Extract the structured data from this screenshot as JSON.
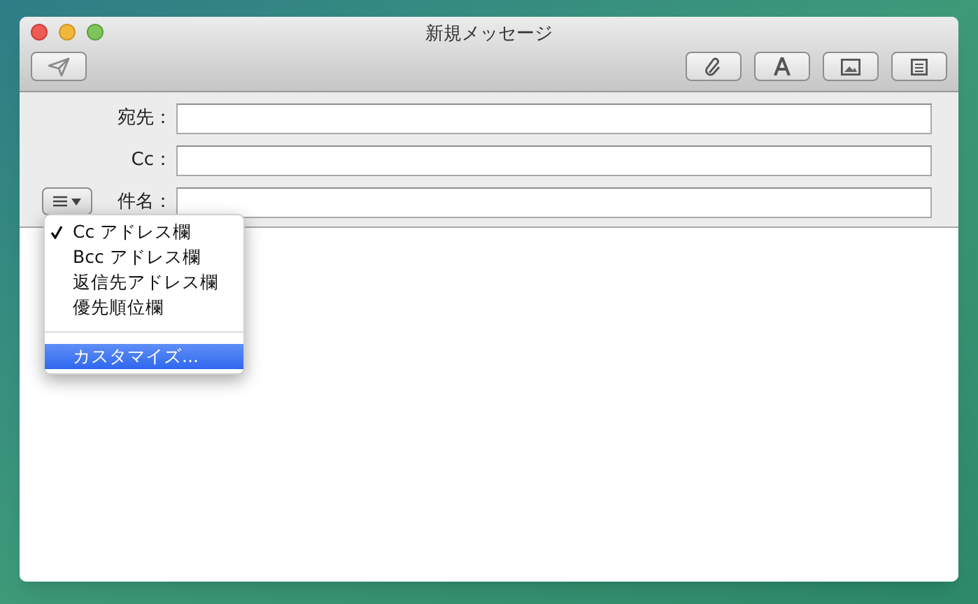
{
  "window": {
    "title": "新規メッセージ"
  },
  "header_fields": [
    {
      "label": "宛先："
    },
    {
      "label": "Cc："
    },
    {
      "label": "件名："
    }
  ],
  "menu": {
    "items": [
      {
        "kind": "toggle",
        "label": "Cc アドレス欄",
        "checked": true,
        "selected": false
      },
      {
        "kind": "toggle",
        "label": "Bcc アドレス欄",
        "checked": false,
        "selected": false
      },
      {
        "kind": "toggle",
        "label": "返信先アドレス欄",
        "checked": false,
        "selected": false
      },
      {
        "kind": "toggle",
        "label": "優先順位欄",
        "checked": false,
        "selected": false
      },
      {
        "kind": "separator"
      },
      {
        "kind": "action",
        "label": "カスタマイズ...",
        "selected": true
      }
    ]
  }
}
